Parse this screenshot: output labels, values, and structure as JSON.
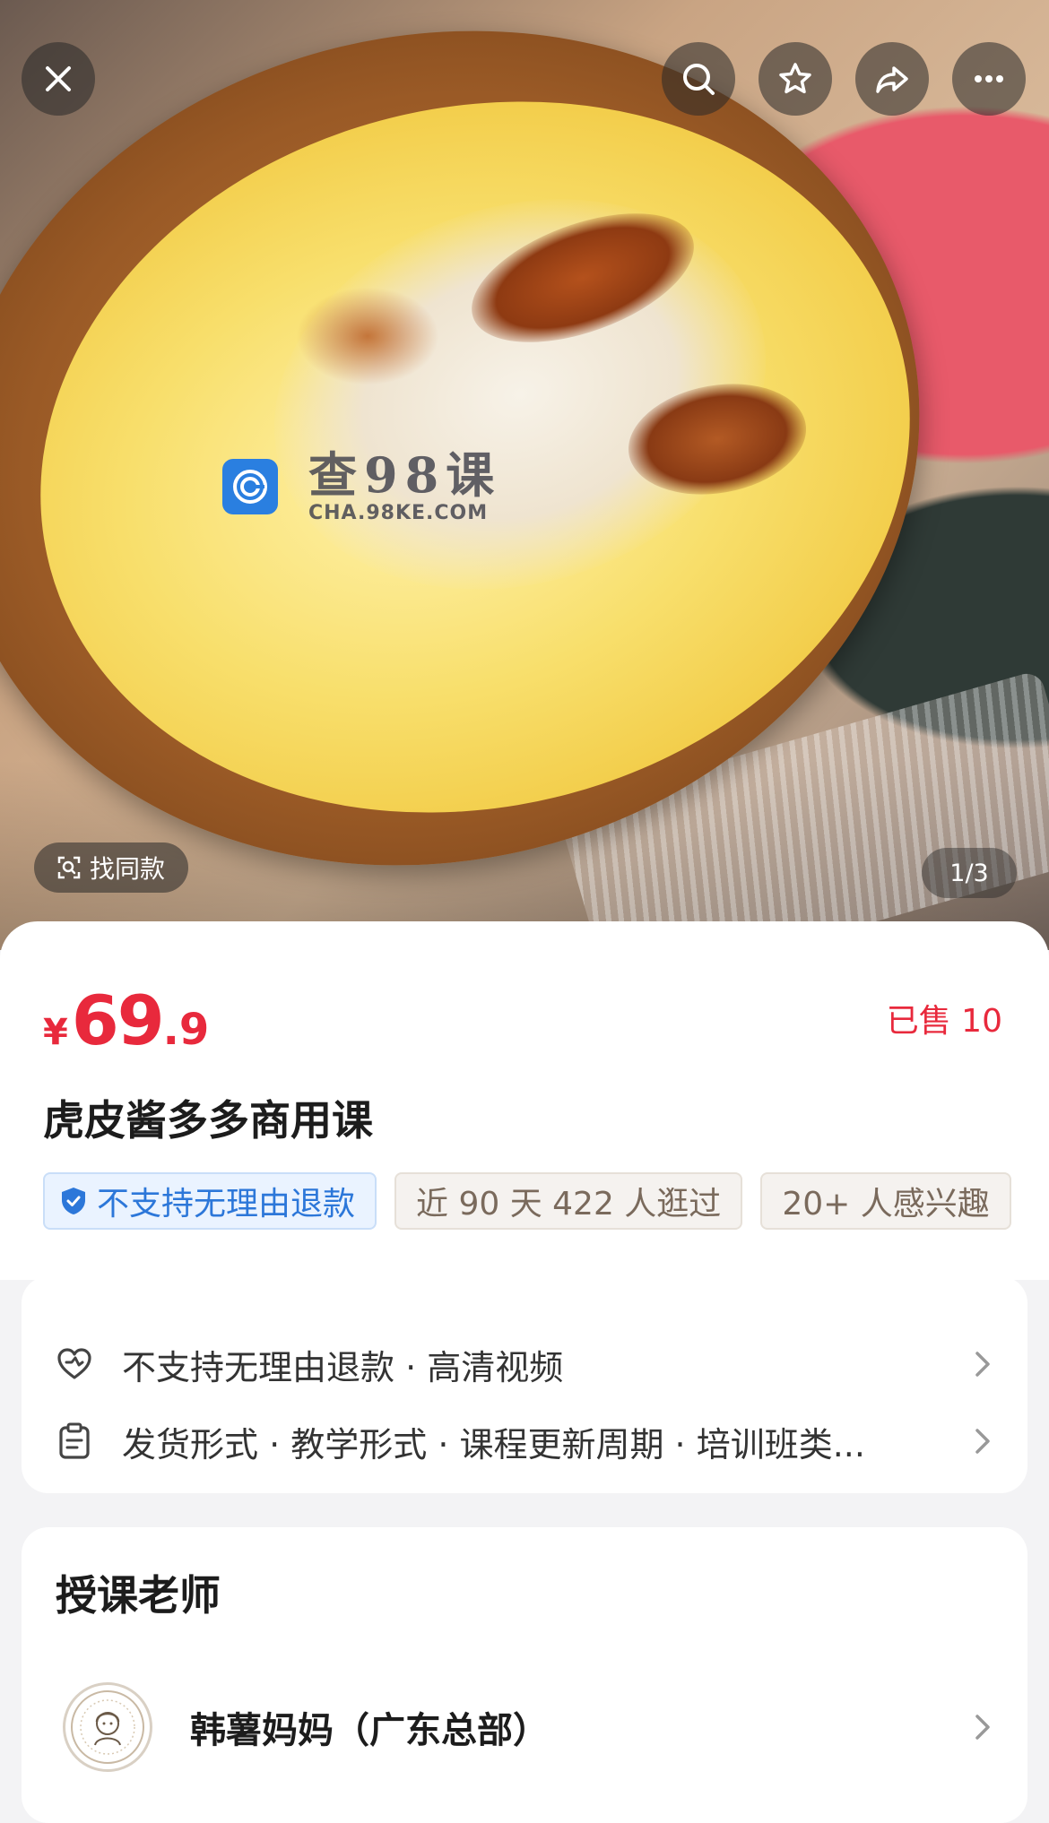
{
  "hero": {
    "watermark_title": "查98课",
    "watermark_sub": "CHA.98KE.COM",
    "find_similar_label": "找同款",
    "page_counter": "1/3"
  },
  "top_bar": {
    "close_icon": "close-icon",
    "search_icon": "search-icon",
    "favorite_icon": "star-icon",
    "share_icon": "share-icon",
    "more_icon": "more-icon"
  },
  "product": {
    "currency": "¥",
    "price_int": "69",
    "price_dec": ".9",
    "sold": "已售 10",
    "title": "虎皮酱多多商用课",
    "tags": [
      "不支持无理由退款",
      "近 90 天 422 人逛过",
      "20+ 人感兴趣"
    ]
  },
  "services": {
    "rows": [
      "不支持无理由退款 · 高清视频",
      "发货形式 · 教学形式 · 课程更新周期 · 培训班类..."
    ]
  },
  "teacher": {
    "heading": "授课老师",
    "name": "韩薯妈妈（广东总部）"
  },
  "colors": {
    "accent_red": "#e8293c",
    "tag_blue": "#2c77d9"
  }
}
